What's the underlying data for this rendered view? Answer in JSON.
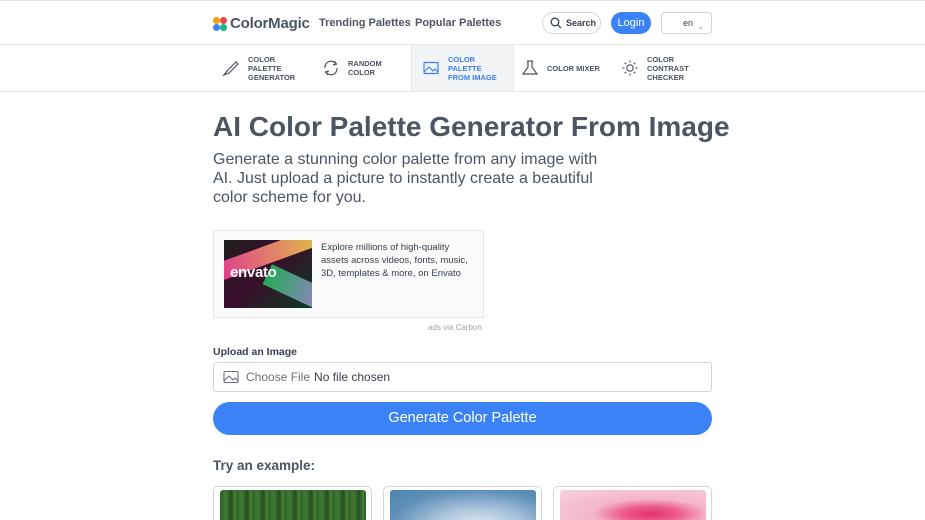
{
  "header": {
    "logo_text": "ColorMagic",
    "nav": [
      "Trending Palettes",
      "Popular Palettes"
    ],
    "search_label": "Search",
    "login_label": "Login",
    "language": "en"
  },
  "tools": [
    {
      "lines": [
        "COLOR",
        "PALETTE",
        "GENERATOR"
      ],
      "icon": "brush-icon",
      "active": false
    },
    {
      "lines": [
        "RANDOM",
        "COLOR"
      ],
      "icon": "refresh-icon",
      "active": false
    },
    {
      "lines": [
        "COLOR",
        "PALETTE",
        "FROM IMAGE"
      ],
      "icon": "image-icon",
      "active": true
    },
    {
      "lines": [
        "COLOR MIXER"
      ],
      "icon": "flask-icon",
      "active": false
    },
    {
      "lines": [
        "COLOR",
        "CONTRAST",
        "CHECKER"
      ],
      "icon": "sun-icon",
      "active": false
    }
  ],
  "main": {
    "title": "AI Color Palette Generator From Image",
    "subtitle": "Generate a stunning color palette from any image with AI. Just upload a picture to instantly create a beautiful color scheme for you."
  },
  "ad": {
    "brand": "envato",
    "text": "Explore millions of high-quality assets across videos, fonts, music, 3D, templates & more, on Envato",
    "via": "ads via Carbon"
  },
  "upload": {
    "label": "Upload an Image",
    "choose_file": "Choose File",
    "no_file": "No file chosen"
  },
  "generate_label": "Generate Color Palette",
  "examples": {
    "title": "Try an example:",
    "items": [
      "forest-thumbnail",
      "sky-thumbnail",
      "tulip-thumbnail"
    ]
  },
  "colors": {
    "accent": "#3b82f6",
    "text": "#4b5563",
    "border": "#e5e7eb"
  }
}
